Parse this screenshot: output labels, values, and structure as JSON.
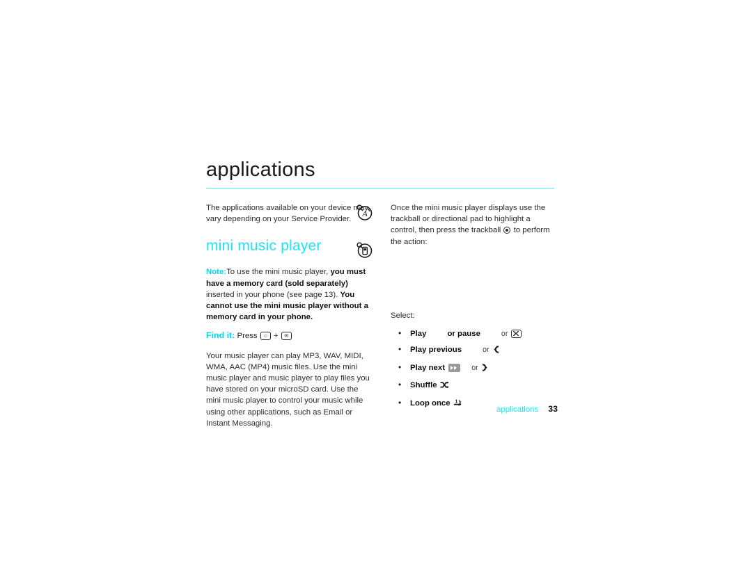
{
  "page": {
    "chapter_title": "applications",
    "footer": {
      "label": "applications",
      "page_number": "33"
    }
  },
  "left_column": {
    "intro_paragraph": "The applications available on your device may vary depending on your Service Provider.",
    "section_heading": "mini music player",
    "note": {
      "label": "Note:",
      "text_1": "To use the mini music player, ",
      "bold_1": "you must have a memory card (sold separately)",
      "text_2": " inserted in your phone (see page 13). ",
      "bold_2": "You cannot use the mini music player without a memory card in your phone."
    },
    "find_it": {
      "label": "Find it:",
      "text": "Press",
      "plus": "+",
      "key_1_name": "menu-key",
      "key_2_name": "message-key"
    },
    "body_paragraph": "Your music player can play MP3, WAV, MIDI, WMA, AAC (MP4) music files. Use the mini music player and music player to play files you have stored on your microSD card. Use the mini music player to control your music while using other applications, such as Email or Instant Messaging."
  },
  "right_column": {
    "intro_text_1": "Once the mini music player displays use the trackball or directional pad to highlight a control, then press the trackball",
    "intro_text_2": "to perform the action:",
    "select_label": "Select:",
    "bullets": [
      {
        "label": "Play",
        "label_2": "or pause",
        "or": "or",
        "icon": "key-box-x"
      },
      {
        "label": "Play previous",
        "or": "or",
        "icon": "skip-previous-icon"
      },
      {
        "label": "Play next",
        "or": "or",
        "icon_1": "fast-forward-button-icon",
        "icon_2": "skip-next-icon"
      },
      {
        "label": "Shuffle",
        "icon": "shuffle-icon"
      },
      {
        "label": "Loop once",
        "icon": "loop-once-icon"
      }
    ]
  },
  "icons": {
    "note_margin": "note-circle-icon",
    "phone_margin": "phone-circle-icon",
    "trackball": "trackball-icon"
  },
  "colors": {
    "accent_cyan": "#19e4fb",
    "rule_cyan": "#9ff0fb",
    "text": "#2b2b2b",
    "background": "#ffffff"
  }
}
